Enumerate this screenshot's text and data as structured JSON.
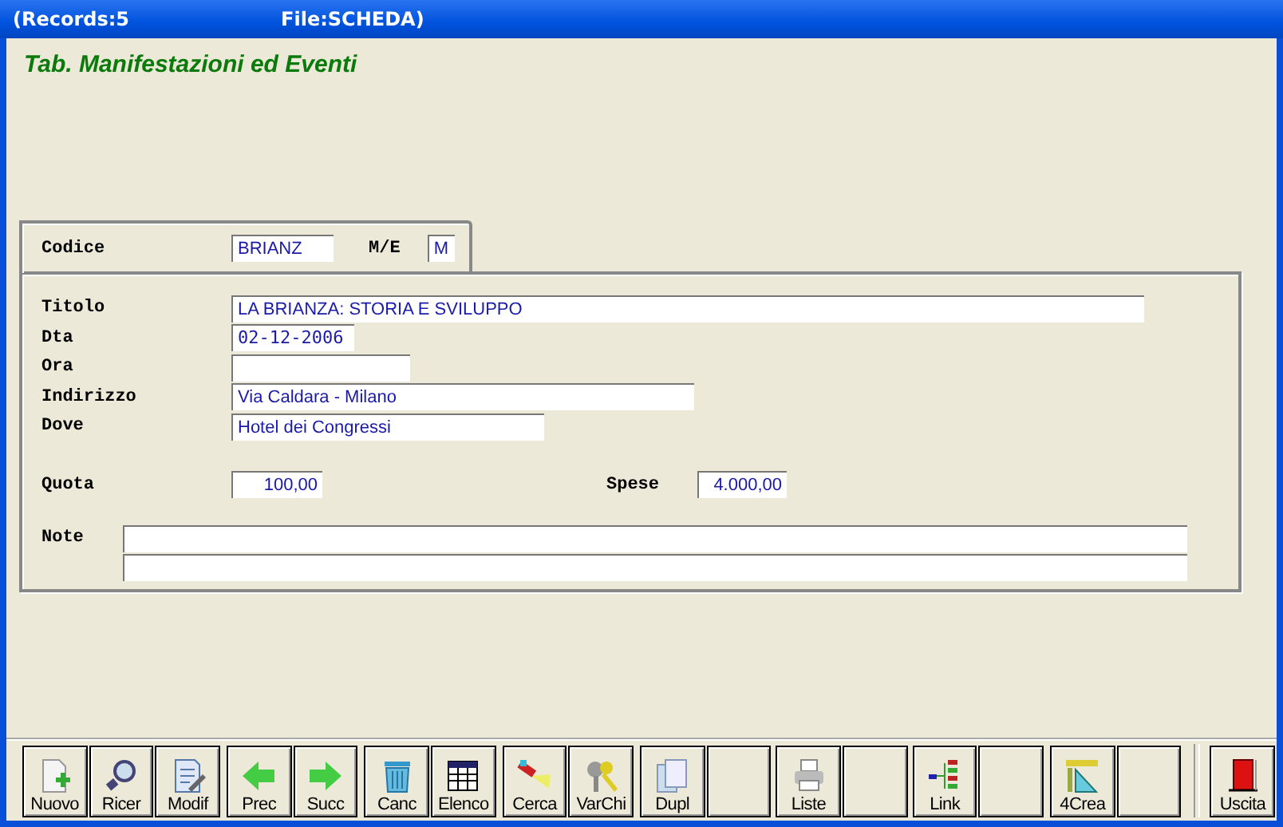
{
  "window": {
    "title_parts": [
      "(Records:5",
      "File:SCHEDA)"
    ]
  },
  "heading": "Tab. Manifestazioni ed Eventi",
  "codice": {
    "label": "Codice",
    "value": "BRIANZ",
    "me_label": "M/E",
    "me_value": "M"
  },
  "fields": [
    {
      "label": "Titolo",
      "value": "LA BRIANZA: STORIA E SVILUPPO"
    },
    {
      "label": "Dta",
      "value": "02-12-2006"
    },
    {
      "label": "Ora"
    },
    {
      "label": "Indirizzo",
      "value": "Via Caldara - Milano"
    },
    {
      "label": "Dove",
      "value": "Hotel dei Congressi"
    }
  ],
  "quota": {
    "label": "Quota",
    "value": "100,00"
  },
  "spese": {
    "label": "Spese",
    "value": "4.000,00"
  },
  "note": {
    "label": "Note"
  },
  "toolbar": [
    {
      "kind": "button",
      "label": "Nuovo"
    },
    {
      "kind": "button",
      "label": "Ricer"
    },
    {
      "kind": "button",
      "label": "Modif"
    },
    {
      "kind": "button",
      "label": "Prec"
    },
    {
      "kind": "button",
      "label": "Succ"
    },
    {
      "kind": "button",
      "label": "Canc"
    },
    {
      "kind": "button",
      "label": "Elenco"
    },
    {
      "kind": "button",
      "label": "Cerca"
    },
    {
      "kind": "button",
      "label": "VarChi"
    },
    {
      "kind": "button",
      "label": "Dupl"
    },
    {
      "kind": "blank"
    },
    {
      "kind": "button",
      "label": "Liste"
    },
    {
      "kind": "blank"
    },
    {
      "kind": "button",
      "label": "Link"
    },
    {
      "kind": "blank"
    },
    {
      "kind": "button",
      "label": "4Crea"
    },
    {
      "kind": "blank"
    },
    {
      "kind": "exit",
      "label": "Uscita"
    }
  ]
}
